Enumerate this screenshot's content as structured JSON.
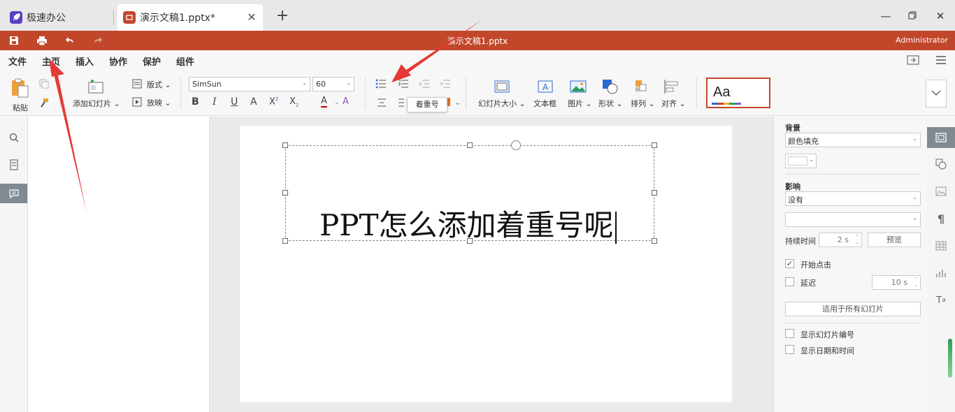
{
  "tabs": [
    {
      "label": "极速办公",
      "icon": "rocket-icon",
      "color": "#5b3fbf"
    },
    {
      "label": "演示文稿1.pptx*",
      "icon": "presentation-icon",
      "color": "#c2472a"
    }
  ],
  "titlebar": {
    "doc_title": "演示文稿1.pptx",
    "user": "Administrator"
  },
  "menu": [
    "文件",
    "主页",
    "插入",
    "协作",
    "保护",
    "组件"
  ],
  "ribbon": {
    "paste": "粘贴",
    "add_slide": "添加幻灯片",
    "layout": "版式",
    "play": "放映",
    "font_name": "SimSun",
    "font_size": "60",
    "slide_size": "幻灯片大小",
    "textbox": "文本框",
    "picture": "图片",
    "shape": "形状",
    "arrange": "排列",
    "align": "对齐",
    "theme_preview": "Aa",
    "tooltip": "着重号"
  },
  "slide": {
    "text": "PPT怎么添加着重号呢"
  },
  "right_panel": {
    "background_label": "背景",
    "fill_value": "颜色填充",
    "effect_label": "影响",
    "effect_value": "没有",
    "duration_label": "持续时间",
    "duration_value": "2 s",
    "preview_button": "预览",
    "start_on_click": "开始点击",
    "delay_label": "延迟",
    "delay_value": "10 s",
    "apply_all": "适用于所有幻灯片",
    "show_slide_number": "显示幻灯片编号",
    "show_date_time": "显示日期和时间"
  },
  "colors": {
    "brand": "#c2472a",
    "annotation_arrow": "#e53935"
  }
}
